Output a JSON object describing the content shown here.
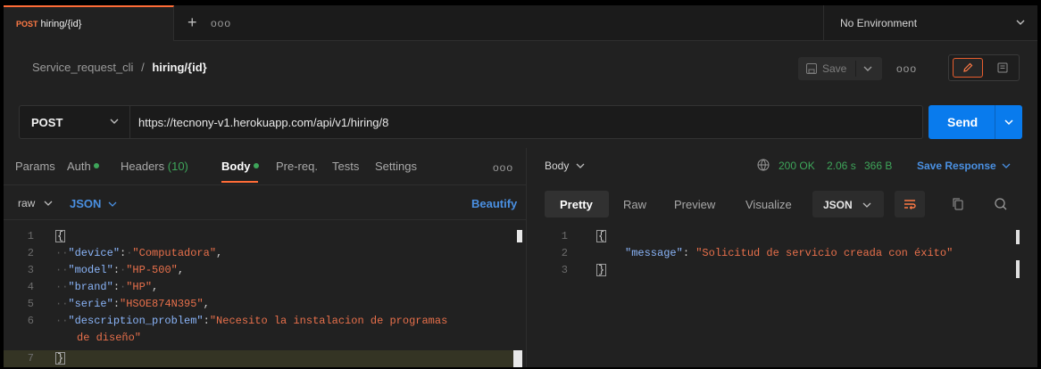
{
  "tab": {
    "method": "POST",
    "name": "hiring/{id}"
  },
  "environment": {
    "label": "No Environment"
  },
  "breadcrumb": {
    "collection": "Service_request_cli",
    "separator": "/",
    "request": "hiring/{id}"
  },
  "toolbar": {
    "save_label": "Save"
  },
  "request": {
    "method": "POST",
    "url": "https://tecnony-v1.herokuapp.com/api/v1/hiring/8",
    "send_label": "Send"
  },
  "request_tabs": {
    "params": "Params",
    "auth": "Auth",
    "headers": "Headers",
    "headers_count": "(10)",
    "body": "Body",
    "prereq": "Pre-req.",
    "tests": "Tests",
    "settings": "Settings"
  },
  "body_format": {
    "mode": "raw",
    "language": "JSON",
    "beautify": "Beautify"
  },
  "request_body": {
    "line_numbers": [
      "1",
      "2",
      "3",
      "4",
      "5",
      "6",
      "7"
    ],
    "open": "{",
    "close": "}",
    "device_key": "\"device\"",
    "device_val": "\"Computadora\"",
    "model_key": "\"model\"",
    "model_val": "\"HP-500\"",
    "brand_key": "\"brand\"",
    "brand_val": "\"HP\"",
    "serie_key": "\"serie\"",
    "serie_val": "\"HSOE874N395\"",
    "desc_key": "\"description_problem\"",
    "desc_val_1": "\"Necesito la instalacion de programas",
    "desc_val_2": "de diseño\""
  },
  "response": {
    "body_label": "Body",
    "status": "200 OK",
    "time": "2.06 s",
    "size": "366 B",
    "save_response": "Save Response",
    "tabs": {
      "pretty": "Pretty",
      "raw": "Raw",
      "preview": "Preview",
      "visualize": "Visualize"
    },
    "language": "JSON",
    "line_numbers": [
      "1",
      "2",
      "3"
    ],
    "open": "{",
    "close": "}",
    "message_key": "\"message\"",
    "message_val": "\"Solicitud de servicio creada con éxito\""
  },
  "colors": {
    "accent": "#ff6c37",
    "send": "#097bed",
    "success": "#3ea55a"
  },
  "icons": [
    "plus-icon",
    "more-icon",
    "chevron-down-icon",
    "save-icon",
    "pencil-icon",
    "documentation-icon",
    "globe-icon",
    "wrap-icon",
    "copy-icon",
    "search-icon"
  ]
}
